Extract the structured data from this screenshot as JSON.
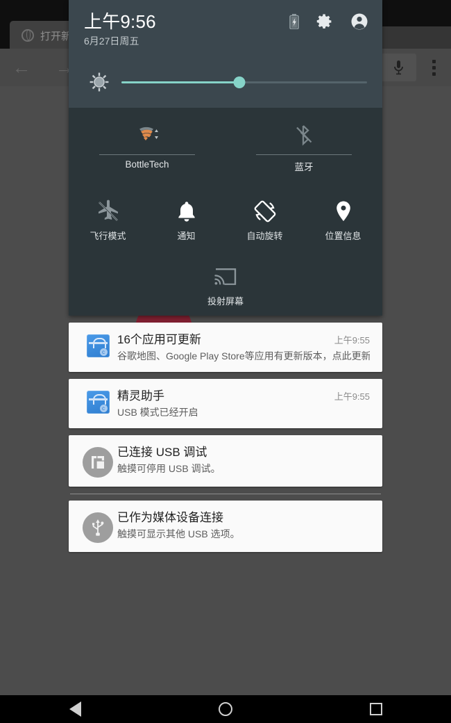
{
  "background_app": {
    "tab_title": "打开新",
    "tab_icon": "globe-icon",
    "back_icon": "back-arrow-icon",
    "forward_icon": "forward-arrow-icon",
    "mic_icon": "microphone-icon",
    "overflow_icon": "overflow-menu-icon"
  },
  "quick_settings": {
    "time": "上午9:56",
    "date": "6月27日周五",
    "battery_icon": "battery-charging-icon",
    "settings_icon": "gear-icon",
    "user_icon": "user-avatar-icon",
    "brightness": {
      "icon": "brightness-sun-icon",
      "value_percent": 48,
      "fill_color": "#86d3c8"
    },
    "tiles_row1": [
      {
        "label": "BottleTech",
        "icon": "wifi-icon",
        "state": "on",
        "color": "#e08b4c"
      },
      {
        "label": "蓝牙",
        "icon": "bluetooth-disabled-icon",
        "state": "off",
        "color": "#7b868b"
      }
    ],
    "tiles_row2": [
      {
        "label": "飞行模式",
        "icon": "airplane-mode-icon",
        "state": "off",
        "color": "#8c969b"
      },
      {
        "label": "通知",
        "icon": "bell-icon",
        "state": "on",
        "color": "#ffffff"
      },
      {
        "label": "自动旋转",
        "icon": "auto-rotate-icon",
        "state": "on",
        "color": "#ffffff"
      },
      {
        "label": "位置信息",
        "icon": "location-pin-icon",
        "state": "on",
        "color": "#ffffff"
      }
    ],
    "tiles_row3": [
      {
        "label": "投射屏幕",
        "icon": "cast-screen-icon",
        "state": "off",
        "color": "#8c969b"
      }
    ]
  },
  "notifications": [
    {
      "icon": "play-store-icon",
      "icon_type": "play",
      "title": "16个应用可更新",
      "text": "谷歌地图、Google Play Store等应用有更新版本，点此更新",
      "time": "上午9:55"
    },
    {
      "icon": "play-store-icon",
      "icon_type": "play",
      "title": "精灵助手",
      "text": "USB 模式已经开启",
      "time": "上午9:55"
    },
    {
      "icon": "usb-debug-icon",
      "icon_type": "debug",
      "title": "已连接 USB 调试",
      "text": "触摸可停用 USB 调试。",
      "time": ""
    },
    {
      "icon": "usb-icon",
      "icon_type": "usb",
      "title": "已作为媒体设备连接",
      "text": "触摸可显示其他 USB 选项。",
      "time": ""
    }
  ],
  "navbar": {
    "back_label": "back-button",
    "home_label": "home-button",
    "recents_label": "recents-button"
  }
}
